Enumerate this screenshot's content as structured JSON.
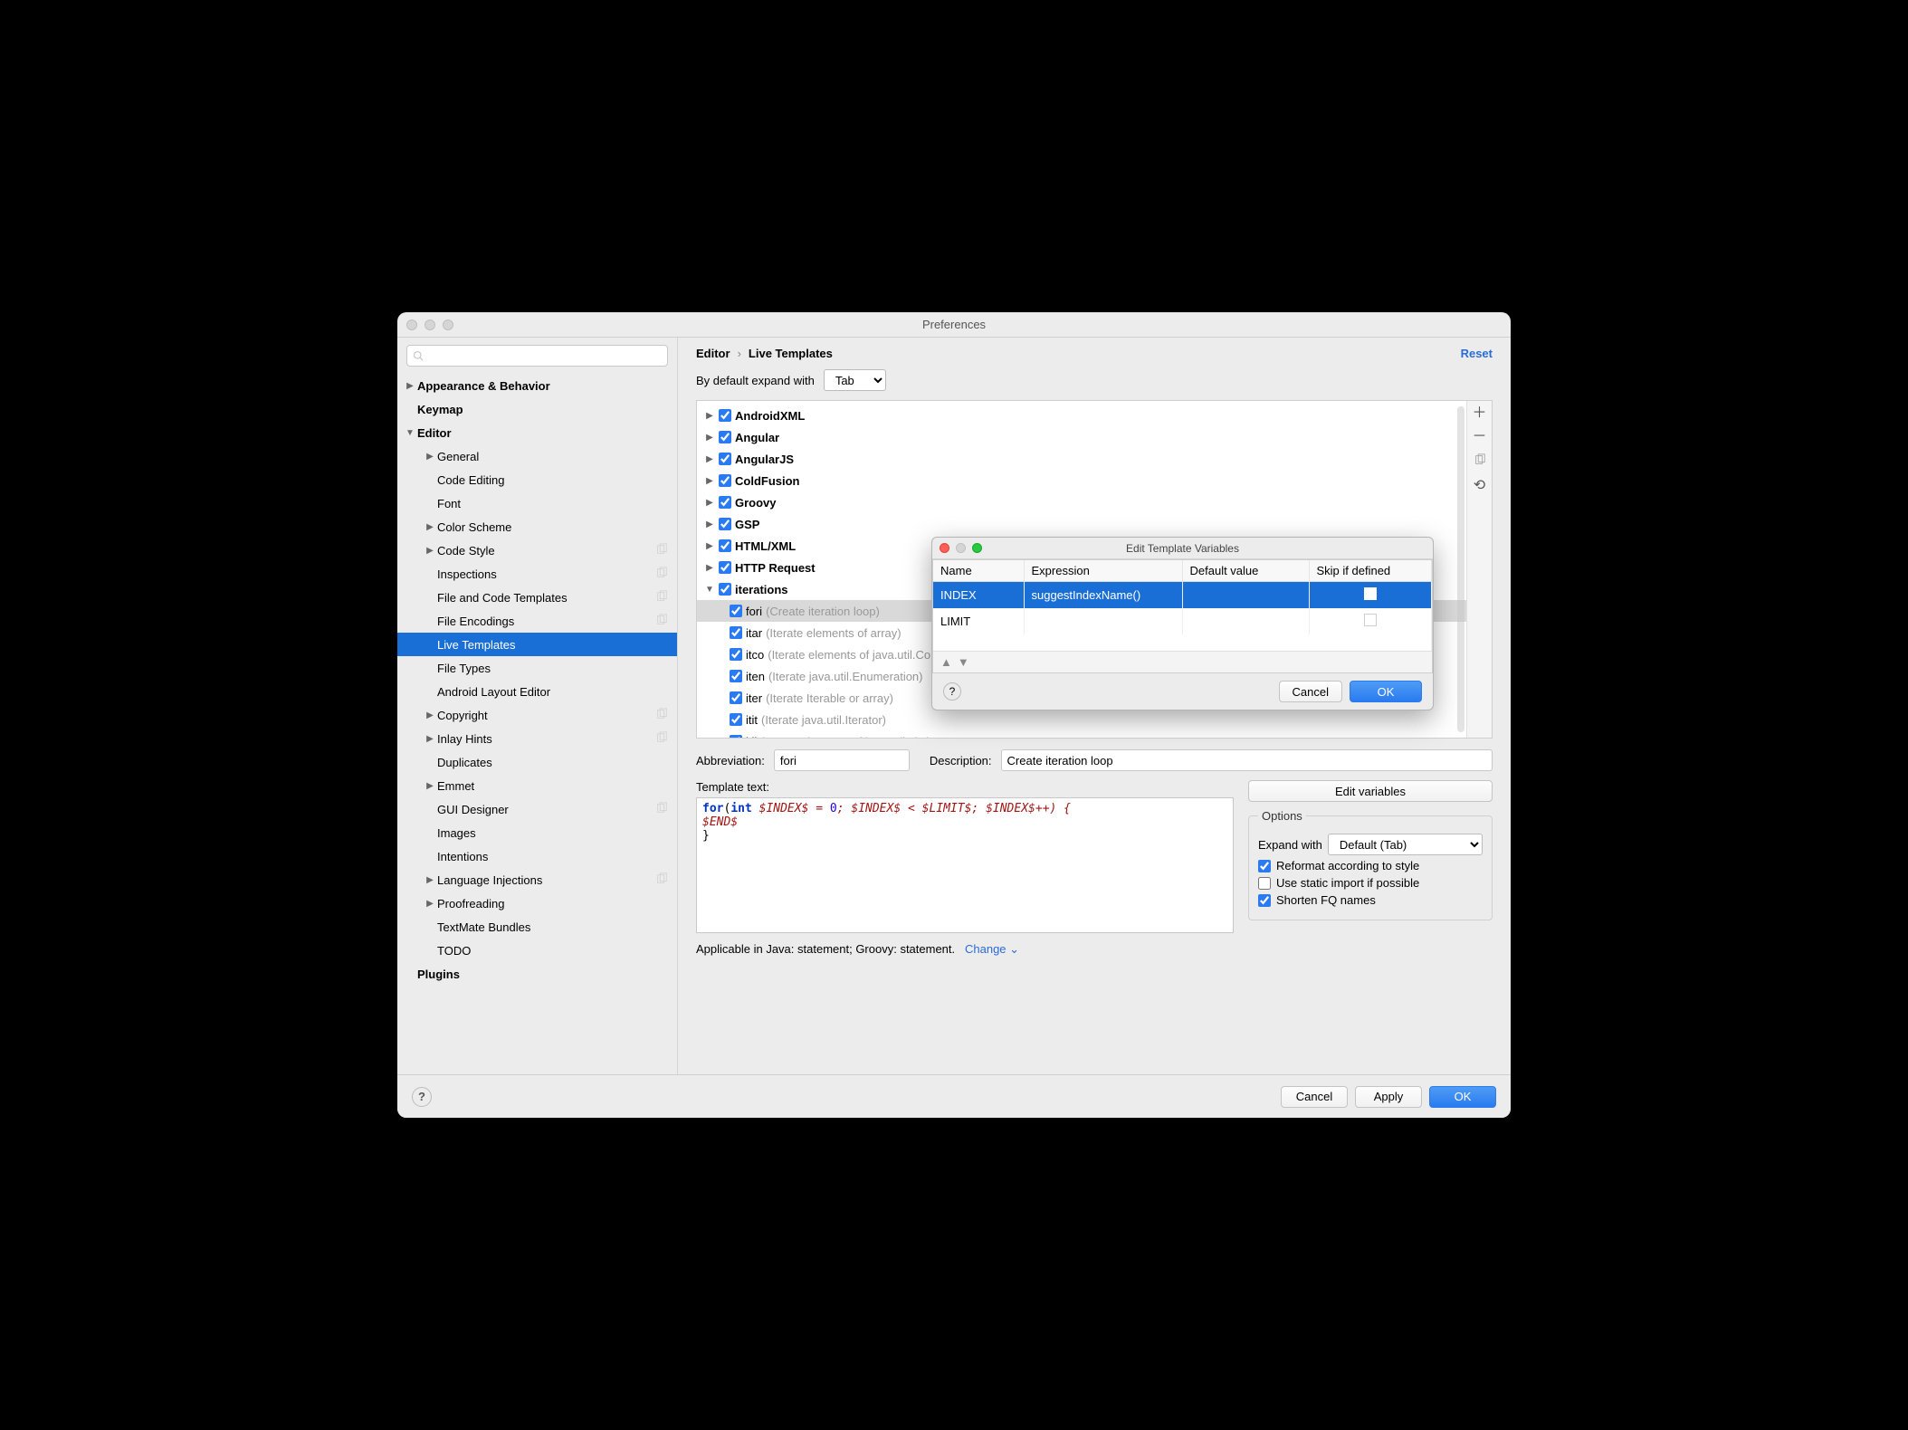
{
  "window": {
    "title": "Preferences"
  },
  "breadcrumb": {
    "root": "Editor",
    "leaf": "Live Templates",
    "reset": "Reset"
  },
  "expand": {
    "label": "By default expand with",
    "value": "Tab"
  },
  "sidebar": {
    "items": [
      {
        "label": "Appearance & Behavior",
        "bold": true,
        "arrow": "right",
        "ind": 0
      },
      {
        "label": "Keymap",
        "bold": true,
        "arrow": "",
        "ind": 0
      },
      {
        "label": "Editor",
        "bold": true,
        "arrow": "down",
        "ind": 0
      },
      {
        "label": "General",
        "bold": false,
        "arrow": "right",
        "ind": 1
      },
      {
        "label": "Code Editing",
        "bold": false,
        "arrow": "",
        "ind": 1
      },
      {
        "label": "Font",
        "bold": false,
        "arrow": "",
        "ind": 1
      },
      {
        "label": "Color Scheme",
        "bold": false,
        "arrow": "right",
        "ind": 1
      },
      {
        "label": "Code Style",
        "bold": false,
        "arrow": "right",
        "ind": 1,
        "badge": true
      },
      {
        "label": "Inspections",
        "bold": false,
        "arrow": "",
        "ind": 1,
        "badge": true
      },
      {
        "label": "File and Code Templates",
        "bold": false,
        "arrow": "",
        "ind": 1,
        "badge": true
      },
      {
        "label": "File Encodings",
        "bold": false,
        "arrow": "",
        "ind": 1,
        "badge": true
      },
      {
        "label": "Live Templates",
        "bold": false,
        "arrow": "",
        "ind": 1,
        "selected": true
      },
      {
        "label": "File Types",
        "bold": false,
        "arrow": "",
        "ind": 1
      },
      {
        "label": "Android Layout Editor",
        "bold": false,
        "arrow": "",
        "ind": 1
      },
      {
        "label": "Copyright",
        "bold": false,
        "arrow": "right",
        "ind": 1,
        "badge": true
      },
      {
        "label": "Inlay Hints",
        "bold": false,
        "arrow": "right",
        "ind": 1,
        "badge": true
      },
      {
        "label": "Duplicates",
        "bold": false,
        "arrow": "",
        "ind": 1
      },
      {
        "label": "Emmet",
        "bold": false,
        "arrow": "right",
        "ind": 1
      },
      {
        "label": "GUI Designer",
        "bold": false,
        "arrow": "",
        "ind": 1,
        "badge": true
      },
      {
        "label": "Images",
        "bold": false,
        "arrow": "",
        "ind": 1
      },
      {
        "label": "Intentions",
        "bold": false,
        "arrow": "",
        "ind": 1
      },
      {
        "label": "Language Injections",
        "bold": false,
        "arrow": "right",
        "ind": 1,
        "badge": true
      },
      {
        "label": "Proofreading",
        "bold": false,
        "arrow": "right",
        "ind": 1
      },
      {
        "label": "TextMate Bundles",
        "bold": false,
        "arrow": "",
        "ind": 1
      },
      {
        "label": "TODO",
        "bold": false,
        "arrow": "",
        "ind": 1
      },
      {
        "label": "Plugins",
        "bold": true,
        "arrow": "",
        "ind": 0
      }
    ]
  },
  "groups": [
    {
      "name": "AndroidXML",
      "arrow": "right"
    },
    {
      "name": "Angular",
      "arrow": "right"
    },
    {
      "name": "AngularJS",
      "arrow": "right"
    },
    {
      "name": "ColdFusion",
      "arrow": "right"
    },
    {
      "name": "Groovy",
      "arrow": "right"
    },
    {
      "name": "GSP",
      "arrow": "right"
    },
    {
      "name": "HTML/XML",
      "arrow": "right"
    },
    {
      "name": "HTTP Request",
      "arrow": "right"
    },
    {
      "name": "iterations",
      "arrow": "down",
      "children": [
        {
          "name": "fori",
          "desc": "(Create iteration loop)",
          "selected": true
        },
        {
          "name": "itar",
          "desc": "(Iterate elements of array)"
        },
        {
          "name": "itco",
          "desc": "(Iterate elements of java.util.Collection)"
        },
        {
          "name": "iten",
          "desc": "(Iterate java.util.Enumeration)"
        },
        {
          "name": "iter",
          "desc": "(Iterate Iterable or array)"
        },
        {
          "name": "itit",
          "desc": "(Iterate java.util.Iterator)"
        },
        {
          "name": "itli",
          "desc": "(Iterate elements of java.util.List)"
        }
      ]
    }
  ],
  "form": {
    "abbr_label": "Abbreviation:",
    "abbr_value": "fori",
    "desc_label": "Description:",
    "desc_value": "Create iteration loop",
    "tmpl_label": "Template text:",
    "edit_vars": "Edit variables"
  },
  "code": {
    "l1a": "for",
    "l1b": "(",
    "l1c": "int",
    "l1d": " $INDEX$ = ",
    "l1e": "0",
    "l1f": "; $INDEX$ < $LIMIT$; $INDEX$++) {",
    "l2": "  $END$",
    "l3": "}"
  },
  "options": {
    "legend": "Options",
    "expand_label": "Expand with",
    "expand_value": "Default (Tab)",
    "reformat": "Reformat according to style",
    "static": "Use static import if possible",
    "shorten": "Shorten FQ names"
  },
  "applicable": {
    "text": "Applicable in Java: statement; Groovy: statement.",
    "change": "Change"
  },
  "footer": {
    "cancel": "Cancel",
    "apply": "Apply",
    "ok": "OK"
  },
  "modal": {
    "title": "Edit Template Variables",
    "headers": {
      "name": "Name",
      "expr": "Expression",
      "def": "Default value",
      "skip": "Skip if defined"
    },
    "rows": [
      {
        "name": "INDEX",
        "expr": "suggestIndexName()",
        "def": "",
        "selected": true
      },
      {
        "name": "LIMIT",
        "expr": "",
        "def": ""
      }
    ],
    "cancel": "Cancel",
    "ok": "OK"
  }
}
